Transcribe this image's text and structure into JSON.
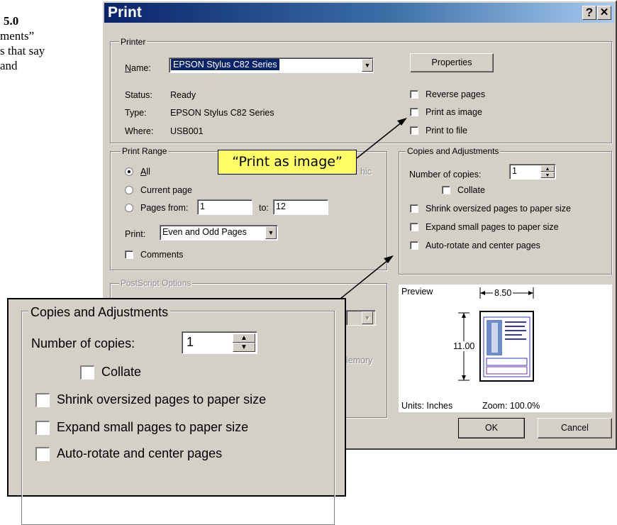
{
  "doc": {
    "line1": "5.0",
    "line2": "ments”",
    "line3": "s that say",
    "line4": "and"
  },
  "dialog": {
    "title": "Print",
    "help_button": "?",
    "close_button": "✕"
  },
  "printer": {
    "legend": "Printer",
    "name_label": "Name:",
    "name_value": "EPSON Stylus C82 Series",
    "properties_label": "Properties",
    "status_label": "Status:",
    "status_value": "Ready",
    "type_label": "Type:",
    "type_value": "EPSON Stylus C82 Series",
    "where_label": "Where:",
    "where_value": "USB001",
    "reverse_pages": "Reverse pages",
    "print_as_image": "Print as image",
    "print_to_file": "Print to file"
  },
  "print_range": {
    "legend": "Print Range",
    "all": "All",
    "current_page": "Current page",
    "pages_from": "Pages from:",
    "from_value": "1",
    "to_label": "to:",
    "to_value": "12",
    "print_label": "Print:",
    "print_value": "Even and Odd Pages",
    "comments": "Comments",
    "hidden_fragment": "hic"
  },
  "copies": {
    "legend": "Copies and Adjustments",
    "number_label": "Number of copies:",
    "number_value": "1",
    "collate": "Collate",
    "shrink": "Shrink oversized pages to paper size",
    "expand": "Expand small pages to paper size",
    "auto_rotate": "Auto-rotate and center pages"
  },
  "postscript": {
    "legend": "PostScript Options",
    "memory_fragment": "lemory"
  },
  "preview": {
    "label": "Preview",
    "width": "8.50",
    "height": "11.00",
    "units": "Units: Inches",
    "zoom": "Zoom: 100.0%"
  },
  "buttons": {
    "ok": "OK",
    "cancel": "Cancel"
  },
  "callout": {
    "text": "“Print as image”"
  },
  "colors": {
    "dialog_face": "#d4d0c8",
    "title_bar": "#0a246a",
    "callout_bg": "#ffff66",
    "selection": "#0a246a"
  }
}
